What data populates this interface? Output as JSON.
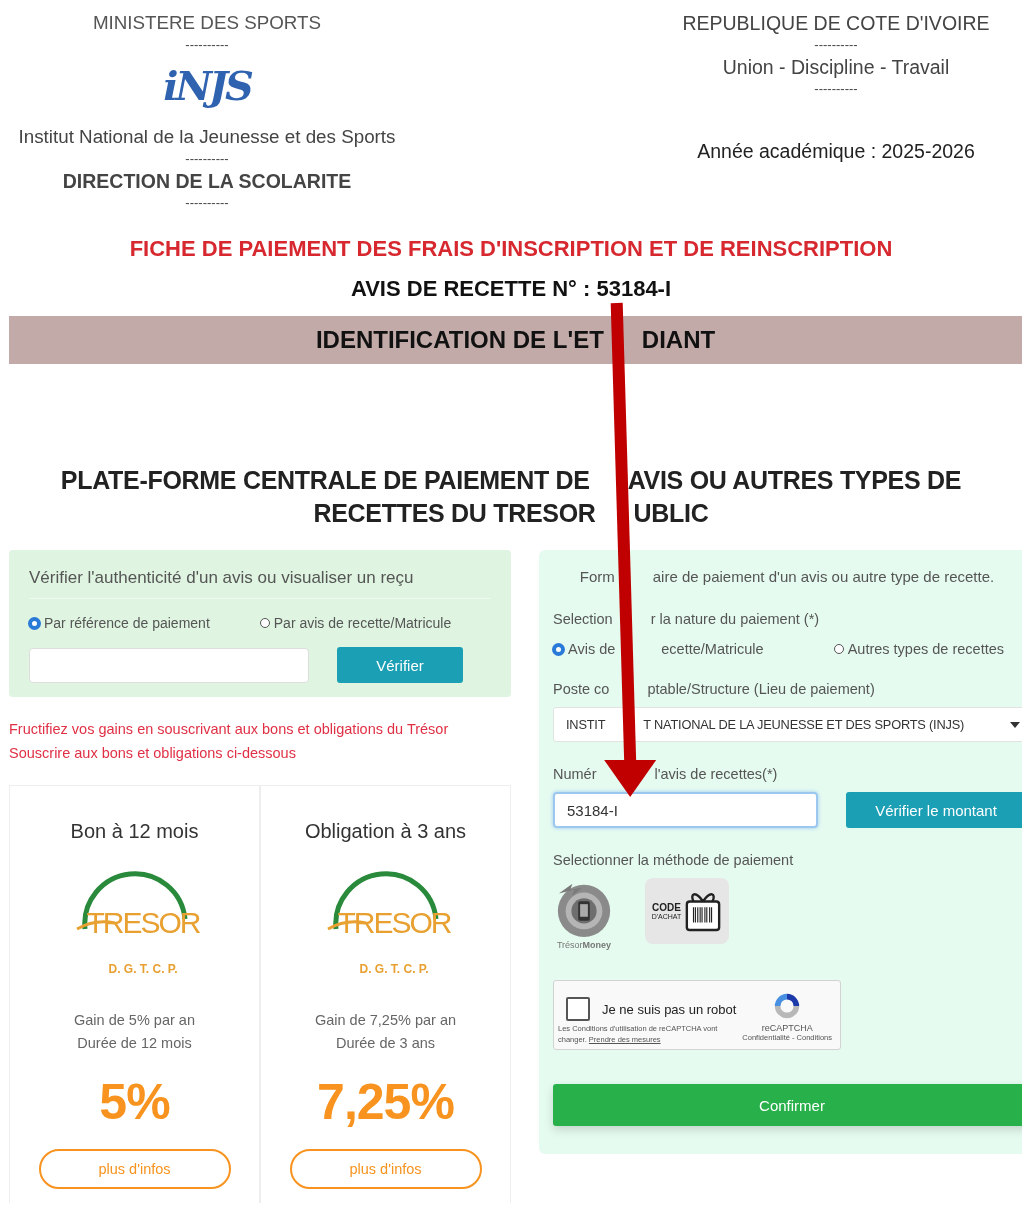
{
  "document": {
    "left": [
      {
        "kind": "text",
        "text": "MINISTERE DES SPORTS"
      },
      {
        "kind": "rule",
        "text": "----------"
      },
      {
        "kind": "logo",
        "text": "iNJS"
      },
      {
        "kind": "text",
        "text": "Institut National de la Jeunesse et des Sports"
      },
      {
        "kind": "rule",
        "text": "----------"
      },
      {
        "kind": "heading",
        "text": "DIRECTION DE LA SCOLARITE"
      },
      {
        "kind": "rule",
        "text": "----------"
      }
    ],
    "right": [
      {
        "kind": "text",
        "text": "REPUBLIQUE DE COTE D'IVOIRE"
      },
      {
        "kind": "rule",
        "text": "----------"
      },
      {
        "kind": "text",
        "text": "Union - Discipline - Travail"
      },
      {
        "kind": "rule",
        "text": "----------"
      },
      {
        "kind": "note",
        "text": "Année académique : 2025-2026"
      }
    ],
    "title": "FICHE DE PAIEMENT DES FRAIS D'INSCRIPTION ET DE REINSCRIPTION",
    "receipt_number": "AVIS DE RECETTE N° : 53184-I",
    "section_band": [
      "IDENTIFICATION DE L'ET",
      "DIANT"
    ]
  },
  "portal": {
    "heading": [
      [
        "PLATE-FORME CENTRALE DE PAIEMENT DE",
        "AVIS OU AUTRES TYPES DE"
      ],
      [
        "RECETTES DU TRESOR",
        "UBLIC"
      ]
    ],
    "verify_card": {
      "title": "Vérifier l'authenticité d'un avis ou visualiser un reçu",
      "options": [
        {
          "label": "Par référence de paiement",
          "selected": true
        },
        {
          "label": "Par avis de recette/Matricule",
          "selected": false
        }
      ],
      "button": "Vérifier"
    },
    "promo": [
      "Fructifiez vos gains en souscrivant aux bons et obligations du Trésor",
      "Souscrire aux bons et obligations ci-dessous"
    ],
    "bonds": [
      {
        "title": "Bon à 12 mois",
        "logo_text": "TRESOR",
        "logo_subtext": "D. G. T. C. P.",
        "details": [
          "Gain de 5% par an",
          "Durée de 12 mois"
        ],
        "rate": "5%",
        "button": "plus d'infos"
      },
      {
        "title": "Obligation à 3 ans",
        "logo_text": "TRESOR",
        "logo_subtext": "D. G. T. C. P.",
        "details": [
          "Gain de 7,25% par an",
          "Durée de 3 ans"
        ],
        "rate": "7,25%",
        "button": "plus d'infos"
      }
    ],
    "payment_form": {
      "title": [
        "Form",
        "aire de paiement d'un avis ou autre type de recette."
      ],
      "nature_label": [
        "Selection",
        "r la nature du paiement (*)"
      ],
      "nature_options": [
        {
          "label": [
            "Avis de",
            "ecette/Matricule"
          ],
          "selected": true
        },
        {
          "label": "Autres types de recettes",
          "selected": false
        }
      ],
      "structure_label": [
        "Poste co",
        "ptable/Structure (Lieu de paiement)"
      ],
      "structure_value": [
        "INSTIT",
        "T NATIONAL DE LA JEUNESSE ET DES SPORTS (INJS)"
      ],
      "number_label": [
        "Numér",
        "l'avis de recettes(*)"
      ],
      "number_value": "53184-I",
      "check_button": "Vérifier le montant",
      "method_label": "Selectionner la méthode de paiement",
      "methods": [
        {
          "kind": "mobile",
          "caption": "Trésor**Money**"
        },
        {
          "kind": "code",
          "code": "CODE",
          "code_sub": "D'ACHAT"
        }
      ],
      "captcha": {
        "label": "Je ne suis pas un robot",
        "checked": false,
        "terms": "Les Conditions d'utilisation de reCAPTCHA vont changer.",
        "terms_link": "Prendre des mesures",
        "brand": "reCAPTCHA",
        "links": "Confidentialité - Conditions"
      },
      "submit": "Confirmer"
    }
  }
}
